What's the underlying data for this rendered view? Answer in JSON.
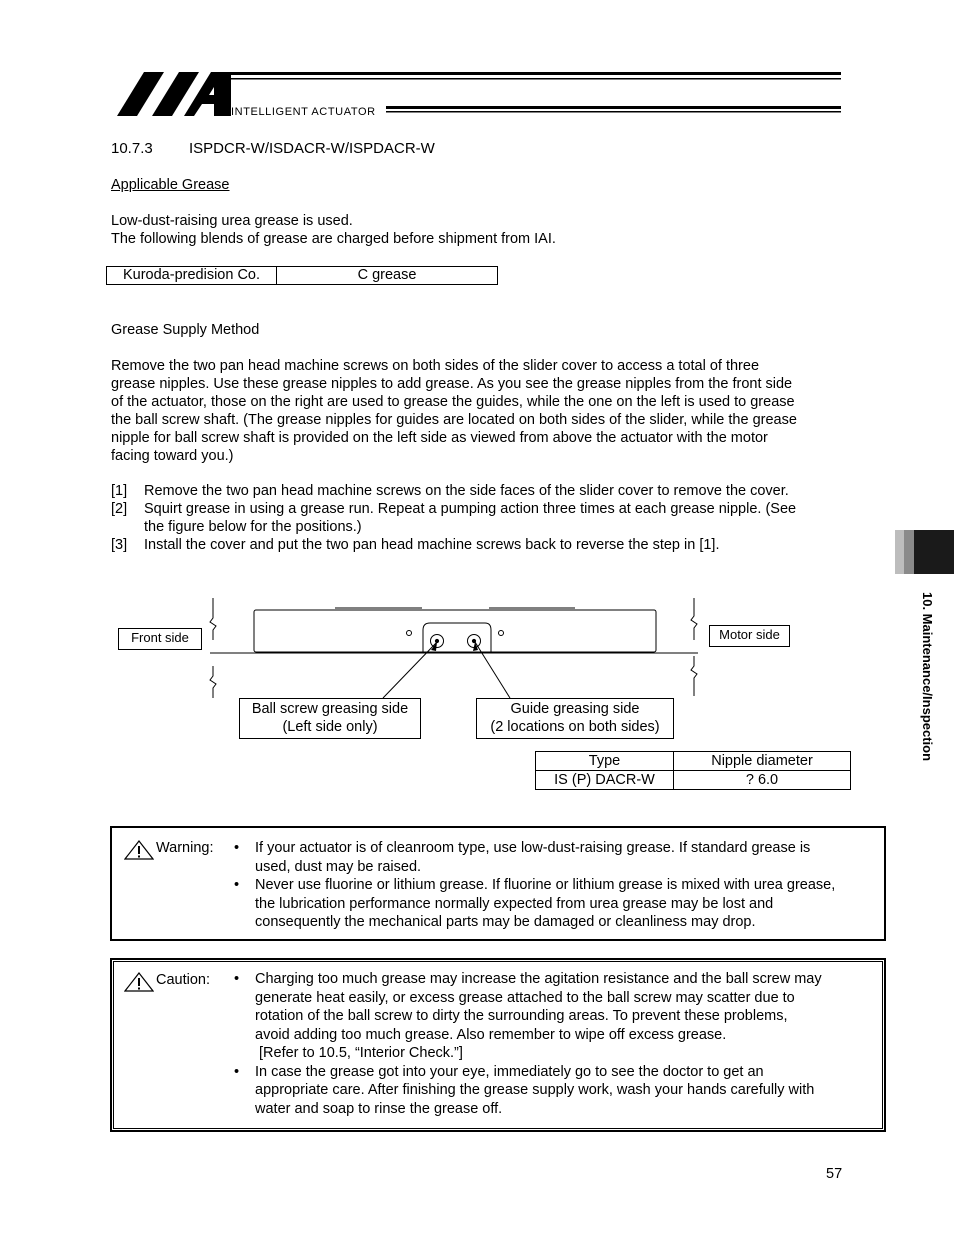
{
  "header": {
    "logo_text": "IAI",
    "logo_tagline": "INTELLIGENT ACTUATOR"
  },
  "section": {
    "number": "10.7.3",
    "title": "ISPDCR-W/ISDACR-W/ISPDACR-W"
  },
  "applicable_grease": {
    "heading": "Applicable Grease",
    "line1": "Low-dust-raising urea grease is used.",
    "line2": "The following blends of grease are charged before shipment from IAI.",
    "table": {
      "maker": "Kuroda-predision Co.",
      "grease": "C grease"
    }
  },
  "supply_method": {
    "heading": "Grease Supply Method",
    "paragraph": [
      "Remove the two pan head machine screws on both sides of the slider cover to access a total of three",
      "grease nipples. Use these grease nipples to add grease. As you see the grease nipples from the front side",
      "of the actuator, those on the right are used to grease the guides, while the one on the left is used to grease",
      "the ball screw shaft. (The grease nipples for guides are located on both sides of the slider, while the grease",
      "nipple for ball screw shaft is provided on the left side as viewed from above the actuator with the motor",
      "facing toward you.)"
    ],
    "steps": [
      {
        "num": "[1]",
        "lines": [
          "Remove the two pan head machine screws on the side faces of the slider cover to remove the cover."
        ]
      },
      {
        "num": "[2]",
        "lines": [
          "Squirt grease in using a grease run. Repeat a pumping action three times at each grease nipple. (See",
          "the figure below for the positions.)"
        ]
      },
      {
        "num": "[3]",
        "lines": [
          "Install the cover and put the two pan head machine screws back to reverse the step in [1]."
        ]
      }
    ]
  },
  "diagram": {
    "front_side": "Front side",
    "motor_side": "Motor side",
    "ball_screw_label": [
      "Ball screw greasing side",
      "(Left side only)"
    ],
    "guide_label": [
      "Guide greasing side",
      "(2 locations on both sides)"
    ]
  },
  "nipple_table": {
    "headers": [
      "Type",
      "Nipple diameter"
    ],
    "rows": [
      [
        "IS (P) DACR-W",
        "? 6.0"
      ]
    ]
  },
  "warning": {
    "label": "Warning:",
    "items": [
      [
        "If your actuator is of cleanroom type, use low-dust-raising grease. If standard grease is",
        "used, dust may be raised."
      ],
      [
        "Never use fluorine or lithium grease. If fluorine or lithium grease is mixed with urea grease,",
        "the lubrication performance normally expected from urea grease may be lost and",
        "consequently the mechanical parts may be damaged or cleanliness may drop."
      ]
    ]
  },
  "caution": {
    "label": "Caution:",
    "items": [
      [
        "Charging too much grease may increase the agitation resistance and the ball screw may",
        "generate heat easily, or excess grease attached to the ball screw may scatter due to",
        "rotation of the ball screw to dirty the surrounding areas. To prevent these problems,",
        "avoid adding too much grease. Also remember to wipe off excess grease.",
        " [Refer to 10.5, “Interior Check.”]"
      ],
      [
        "In case the grease got into your eye, immediately go to see the doctor to get an",
        "appropriate care. After finishing the grease supply work, wash your hands carefully with",
        "water and soap to rinse the grease off."
      ]
    ]
  },
  "side_tab": {
    "text": "10. Maintenance/Inspection"
  },
  "page_number": "57"
}
